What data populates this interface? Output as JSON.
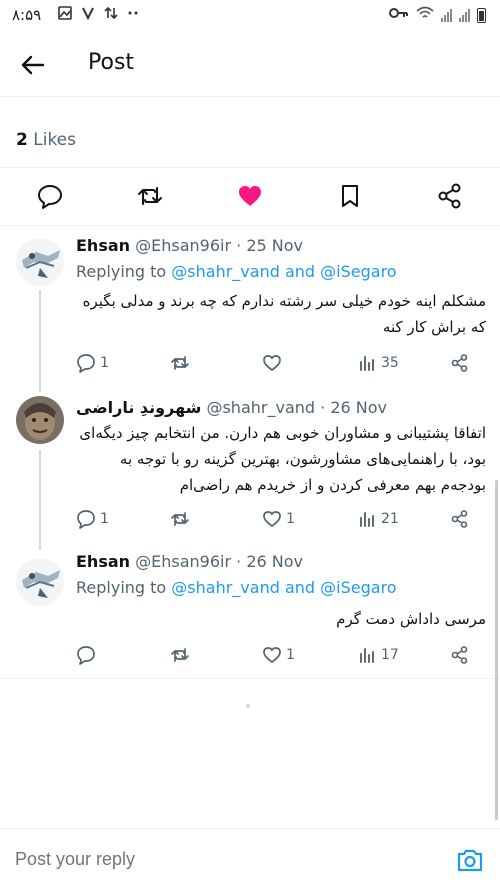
{
  "status_bar": {
    "time": "۸:۵۹"
  },
  "header": {
    "title": "Post"
  },
  "likes": {
    "count": "2",
    "label": "Likes"
  },
  "colors": {
    "accent": "#1d9bf0",
    "like": "#f91880",
    "text": "#0f1419",
    "muted": "#536471"
  },
  "action_icons": [
    "reply-icon",
    "retweet-icon",
    "like-icon-filled",
    "bookmark-icon",
    "share-icon"
  ],
  "replies": [
    {
      "name": "Ehsan",
      "handle": "@Ehsan96ir",
      "date": "· 25 Nov",
      "replying_prefix": "Replying to",
      "mention1": "@shahr_vand",
      "and_word": "and",
      "mention2": "@iSegaro",
      "text": "مشکلم اینه خودم خیلی سر رشته ندارم که چه برند و مدلی بگیره که براش کار کنه",
      "reply_count": "1",
      "retweet_count": "",
      "like_count": "",
      "view_count": "35"
    },
    {
      "name": "شهروندِ ناراضی",
      "handle": "@shahr_vand",
      "date": "· 26 Nov",
      "text": "اتفاقا پشتیبانی و مشاوران خوبی هم دارن. من انتخابم چیز دیگه‌ای بود، با راهنمایی‌های مشاورشون، بهترین گزینه رو با توجه به بودجه‌م بهم معرفی کردن و از خریدم هم راضی‌ام",
      "reply_count": "1",
      "retweet_count": "",
      "like_count": "1",
      "view_count": "21"
    },
    {
      "name": "Ehsan",
      "handle": "@Ehsan96ir",
      "date": "· 26 Nov",
      "replying_prefix": "Replying to",
      "mention1": "@shahr_vand",
      "and_word": "and",
      "mention2": "@iSegaro",
      "text": "مرسی داداش دمت گرم",
      "reply_count": "",
      "retweet_count": "",
      "like_count": "1",
      "view_count": "17"
    }
  ],
  "reply_box": {
    "placeholder": "Post your reply"
  }
}
